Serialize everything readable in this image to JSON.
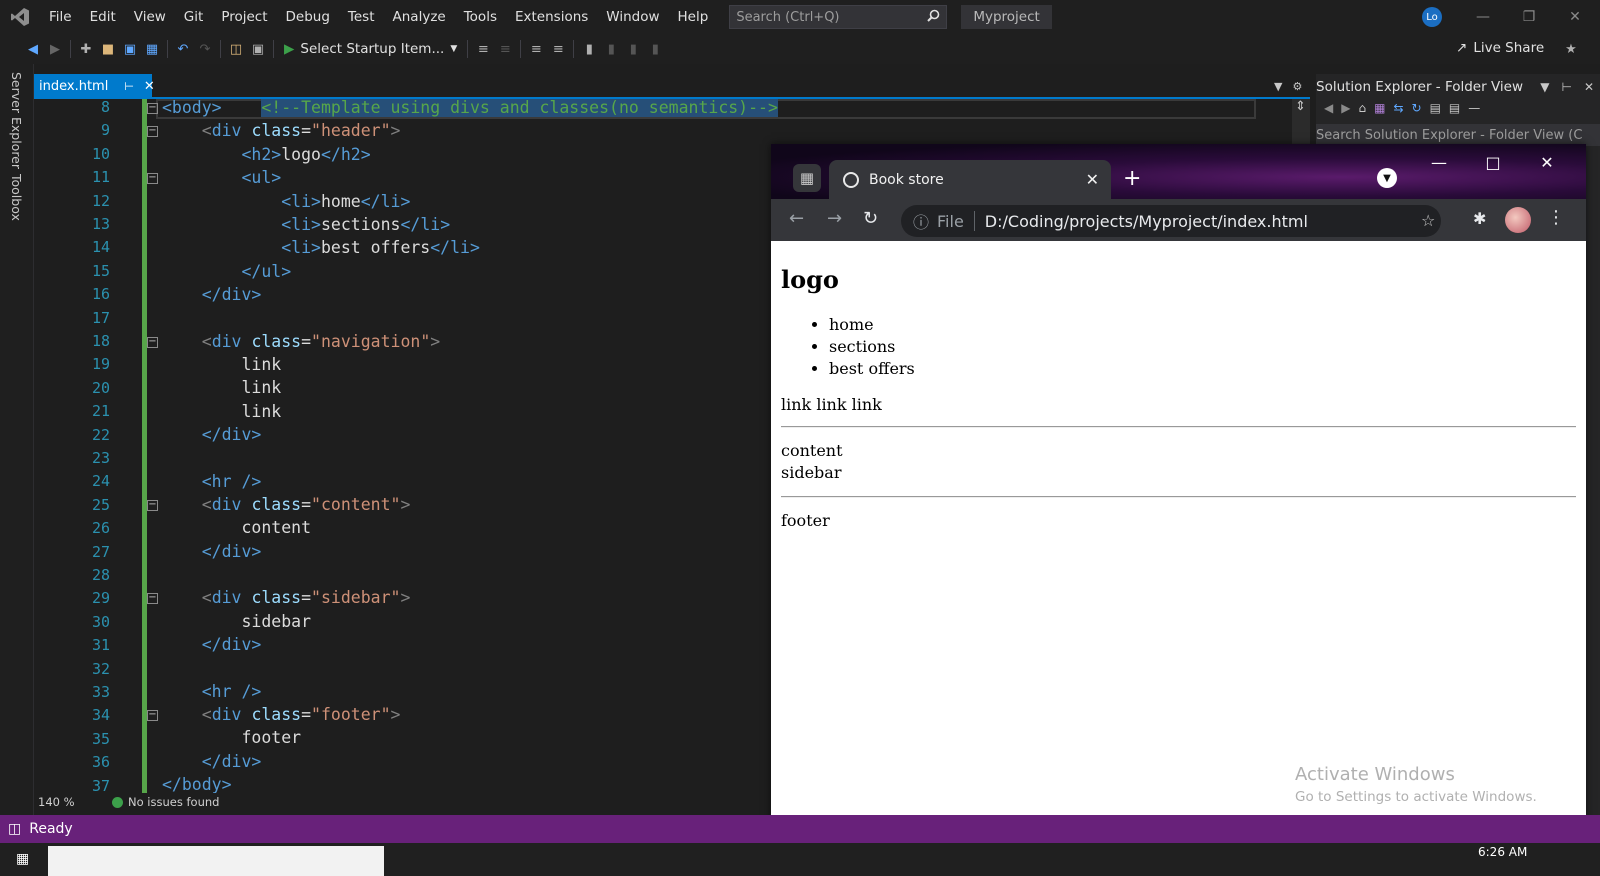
{
  "menu": {
    "items": [
      "File",
      "Edit",
      "View",
      "Git",
      "Project",
      "Debug",
      "Test",
      "Analyze",
      "Tools",
      "Extensions",
      "Window",
      "Help"
    ],
    "search_placeholder": "Search (Ctrl+Q)",
    "project_name": "Myproject",
    "user_initials": "Lo"
  },
  "toolbar": {
    "startup_label": "Select Startup Item...",
    "live_share": "Live Share"
  },
  "side_rail": {
    "server_explorer": "Server Explorer",
    "toolbox": "Toolbox"
  },
  "editor": {
    "tab_name": "index.html",
    "zoom": "140 %",
    "issues": "No issues found",
    "lines": [
      {
        "n": "8"
      },
      {
        "n": "9"
      },
      {
        "n": "10"
      },
      {
        "n": "11"
      },
      {
        "n": "12"
      },
      {
        "n": "13"
      },
      {
        "n": "14"
      },
      {
        "n": "15"
      },
      {
        "n": "16"
      },
      {
        "n": "17"
      },
      {
        "n": "18"
      },
      {
        "n": "19"
      },
      {
        "n": "20"
      },
      {
        "n": "21"
      },
      {
        "n": "22"
      },
      {
        "n": "23"
      },
      {
        "n": "24"
      },
      {
        "n": "25"
      },
      {
        "n": "26"
      },
      {
        "n": "27"
      },
      {
        "n": "28"
      },
      {
        "n": "29"
      },
      {
        "n": "30"
      },
      {
        "n": "31"
      },
      {
        "n": "32"
      },
      {
        "n": "33"
      },
      {
        "n": "34"
      },
      {
        "n": "35"
      },
      {
        "n": "36"
      },
      {
        "n": "37"
      }
    ],
    "code": {
      "body_open": "<body>",
      "comment": "<!--Template using divs and classes(no semantics)-->",
      "div_tag": "div",
      "class_attr": "class",
      "header_cls": "\"header\"",
      "h2_open": "<h2>",
      "h2_close": "</h2>",
      "logo": "logo",
      "ul_open": "<ul>",
      "ul_close": "</ul>",
      "li_open": "<li>",
      "li_close": "</li>",
      "li1": "home",
      "li2": "sections",
      "li3": "best offers",
      "div_close": "</div>",
      "nav_cls": "\"navigation\"",
      "link": "link",
      "hr": "<hr />",
      "content_cls": "\"content\"",
      "content": "content",
      "sidebar_cls": "\"sidebar\"",
      "sidebar": "sidebar",
      "footer_cls": "\"footer\"",
      "footer": "footer",
      "body_close": "</body>"
    }
  },
  "solution_explorer": {
    "title": "Solution Explorer - Folder View",
    "search_placeholder": "Search Solution Explorer - Folder View (C"
  },
  "status": {
    "ready": "Ready",
    "clock": "6:26 AM"
  },
  "browser": {
    "tab_title": "Book store",
    "scheme": "File",
    "url": "D:/Coding/projects/Myproject/index.html",
    "page": {
      "logo": "logo",
      "list": [
        "home",
        "sections",
        "best offers"
      ],
      "links": "link link link",
      "content": "content",
      "sidebar": "sidebar",
      "footer": "footer"
    },
    "watermark": {
      "title": "Activate Windows",
      "subtitle": "Go to Settings to activate Windows."
    }
  },
  "colors": {
    "accent": "#007acc",
    "status_bar": "#68217a",
    "tag": "#569cd6",
    "attr": "#9cdcfe",
    "string": "#ce9178",
    "comment": "#57a64a",
    "line_number": "#2b91af"
  }
}
